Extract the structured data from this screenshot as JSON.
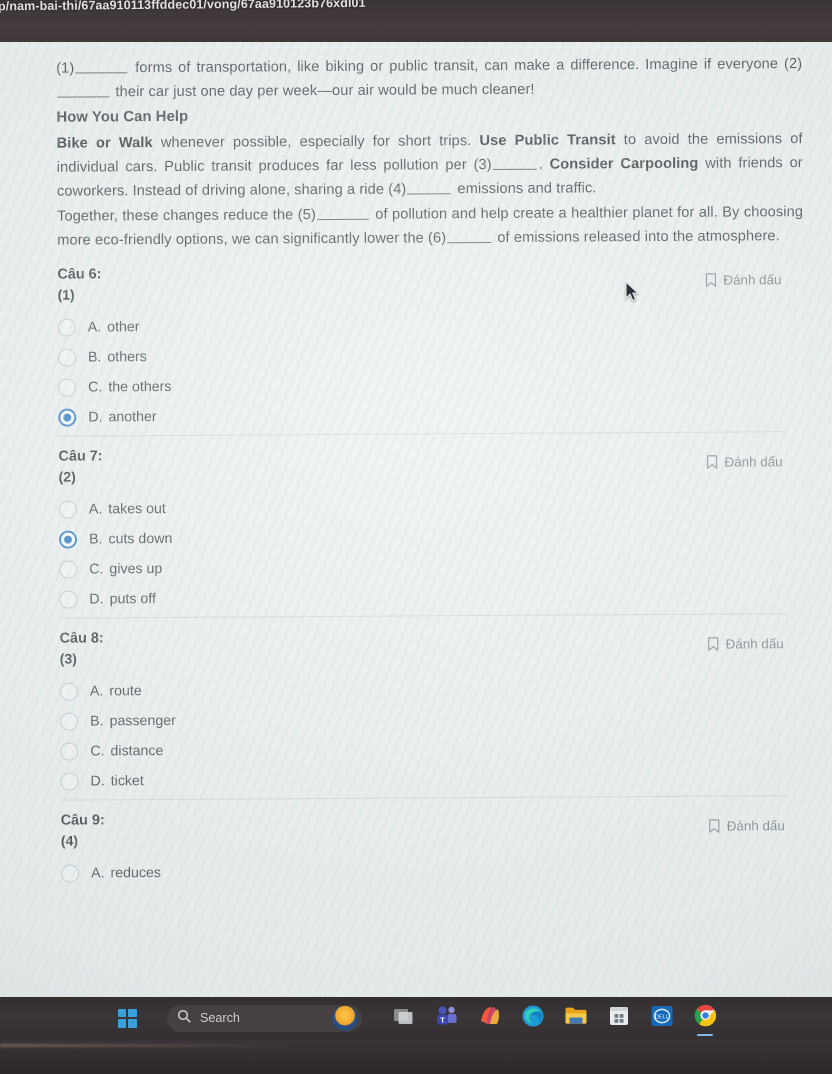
{
  "browser": {
    "url": "p/nam-bai-thi/67aa910113ffddec01/vong/67aa910123b76xdl01"
  },
  "passage": {
    "line1_prefix": "(1)",
    "line1_mid": " forms of transportation, like biking or public transit, can make a difference. Imagine if everyone (2)",
    "line1_end": " their car just one day per week—our air would be much cleaner!",
    "heading": "How You Can Help",
    "para2_bold1": "Bike or Walk",
    "para2_t1": " whenever possible, especially for short trips. ",
    "para2_bold2": "Use Public Transit",
    "para2_t2": " to avoid the emissions of individual cars. Public transit produces far less pollution per (3)",
    "para2_t3": ". ",
    "para2_bold3": "Consider Carpooling",
    "para2_t4": " with friends or coworkers. Instead of driving alone, sharing a ride (4)",
    "para2_t5": " emissions and traffic.",
    "para3_t1": "Together, these changes reduce the (5)",
    "para3_t2": " of pollution and help create a healthier planet for all. By choosing more eco-friendly options, we can significantly lower the (6)",
    "para3_t3": " of emissions released into the atmosphere."
  },
  "bookmark_label": "Đánh dấu",
  "questions": [
    {
      "title": "Câu 6:",
      "subtitle": "(1)",
      "selected": 3,
      "options": [
        {
          "letter": "A.",
          "text": "other"
        },
        {
          "letter": "B.",
          "text": "others"
        },
        {
          "letter": "C.",
          "text": "the others"
        },
        {
          "letter": "D.",
          "text": "another"
        }
      ]
    },
    {
      "title": "Câu 7:",
      "subtitle": "(2)",
      "selected": 1,
      "options": [
        {
          "letter": "A.",
          "text": "takes out"
        },
        {
          "letter": "B.",
          "text": "cuts down"
        },
        {
          "letter": "C.",
          "text": "gives up"
        },
        {
          "letter": "D.",
          "text": "puts off"
        }
      ]
    },
    {
      "title": "Câu 8:",
      "subtitle": "(3)",
      "selected": -1,
      "options": [
        {
          "letter": "A.",
          "text": "route"
        },
        {
          "letter": "B.",
          "text": "passenger"
        },
        {
          "letter": "C.",
          "text": "distance"
        },
        {
          "letter": "D.",
          "text": "ticket"
        }
      ]
    },
    {
      "title": "Câu 9:",
      "subtitle": "(4)",
      "selected": -1,
      "options": [
        {
          "letter": "A.",
          "text": "reduces"
        }
      ]
    }
  ],
  "taskbar": {
    "search_placeholder": "Search",
    "items": [
      {
        "name": "start-button",
        "icon": "windows-logo-icon"
      },
      {
        "name": "search-box",
        "icon": "search-icon"
      },
      {
        "name": "task-view-button",
        "icon": "task-view-icon"
      },
      {
        "name": "teams-button",
        "icon": "teams-icon"
      },
      {
        "name": "office-button",
        "icon": "office-icon"
      },
      {
        "name": "edge-button",
        "icon": "edge-icon"
      },
      {
        "name": "file-explorer-button",
        "icon": "folder-icon"
      },
      {
        "name": "microsoft-store-button",
        "icon": "store-icon"
      },
      {
        "name": "dell-button",
        "icon": "dell-icon"
      },
      {
        "name": "chrome-button",
        "icon": "chrome-icon"
      }
    ]
  },
  "colors": {
    "accent_blue": "#1d6fbd",
    "page_bg": "#eceeef",
    "taskbar_bg": "#332f31"
  }
}
